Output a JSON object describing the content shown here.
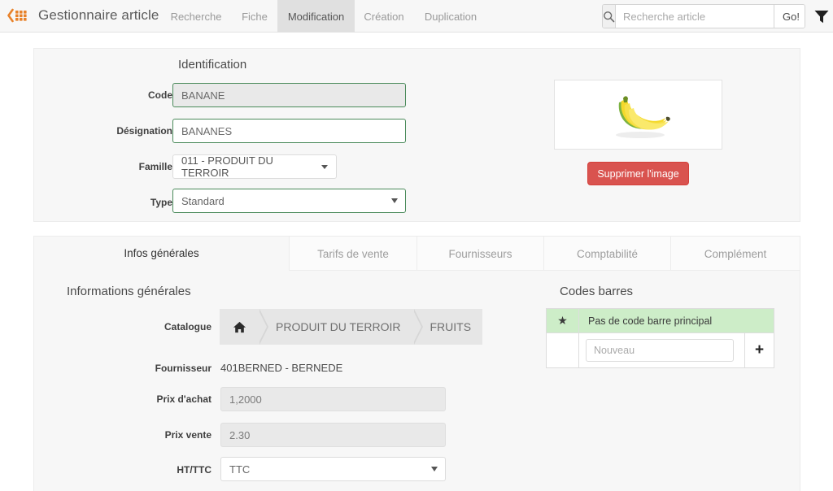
{
  "header": {
    "logo_icon": "grid-back-icon",
    "app_title": "Gestionnaire article",
    "nav": [
      {
        "label": "Recherche",
        "active": false
      },
      {
        "label": "Fiche",
        "active": false
      },
      {
        "label": "Modification",
        "active": true
      },
      {
        "label": "Création",
        "active": false
      },
      {
        "label": "Duplication",
        "active": false
      }
    ],
    "search": {
      "icon": "search-icon",
      "placeholder": "Recherche article",
      "value": "",
      "go_label": "Go!"
    },
    "filter_icon": "funnel-filter-icon"
  },
  "identification": {
    "title": "Identification",
    "fields": {
      "code_label": "Code",
      "code_value": "BANANE",
      "designation_label": "Désignation",
      "designation_value": "BANANES",
      "famille_label": "Famille",
      "famille_value": "011 - PRODUIT DU TERROIR",
      "type_label": "Type",
      "type_value": "Standard"
    },
    "image": {
      "alt": "banana-bunch-image",
      "delete_label": "Supprimer l'image"
    }
  },
  "content_tabs": [
    {
      "label": "Infos générales",
      "active": true
    },
    {
      "label": "Tarifs de vente",
      "active": false
    },
    {
      "label": "Fournisseurs",
      "active": false
    },
    {
      "label": "Comptabilité",
      "active": false
    },
    {
      "label": "Complément",
      "active": false
    }
  ],
  "infos_generales": {
    "title": "Informations générales",
    "catalogue_label": "Catalogue",
    "catalogue_crumbs": [
      "home-icon",
      "PRODUIT DU TERROIR",
      "FRUITS"
    ],
    "fournisseur_label": "Fournisseur",
    "fournisseur_value": "401BERNED - BERNEDE",
    "prix_achat_label": "Prix d'achat",
    "prix_achat_value": "1,2000",
    "prix_vente_label": "Prix vente",
    "prix_vente_value": "2.30",
    "httc_label": "HT/TTC",
    "httc_value": "TTC"
  },
  "codes_barres": {
    "title": "Codes barres",
    "star_icon": "star-icon",
    "main_row_label": "Pas de code barre principal",
    "new_placeholder": "Nouveau",
    "new_value": "",
    "add_label": "+"
  },
  "colors": {
    "accent_orange": "#E8822A",
    "danger_red": "#d9534f",
    "field_green": "#4a8a5a",
    "row_green": "#cdedc8",
    "active_tab_gray": "#e0e0e0"
  }
}
